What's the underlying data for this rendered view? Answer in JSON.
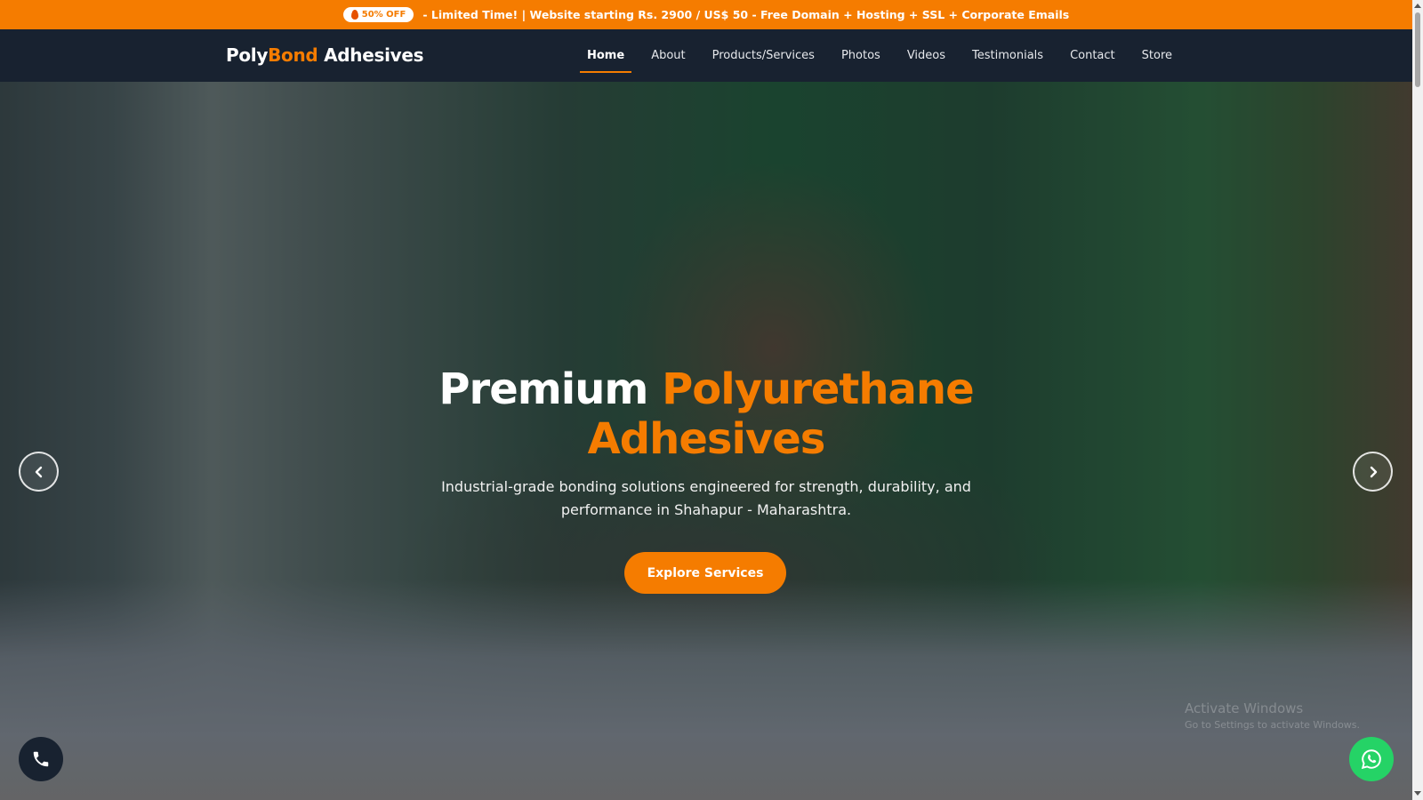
{
  "promo": {
    "badge": "50% OFF",
    "text": "- Limited Time! | Website starting Rs. 2900 / US$ 50 - Free Domain + Hosting + SSL + Corporate Emails"
  },
  "brand": {
    "part1": "Poly",
    "part2": "Bond",
    "part3": " Adhesives"
  },
  "nav": {
    "items": [
      {
        "label": "Home",
        "active": true
      },
      {
        "label": "About"
      },
      {
        "label": "Products/Services"
      },
      {
        "label": "Photos"
      },
      {
        "label": "Videos"
      },
      {
        "label": "Testimonials"
      },
      {
        "label": "Contact"
      },
      {
        "label": "Store"
      }
    ]
  },
  "hero": {
    "title_white": "Premium ",
    "title_orange_line1": "Polyurethane",
    "title_orange_line2": "Adhesives",
    "subtitle": "Industrial-grade bonding solutions engineered for strength, durability, and performance in Shahapur - Maharashtra.",
    "cta": "Explore Services"
  },
  "watermark": {
    "line1": "Activate Windows",
    "line2": "Go to Settings to activate Windows."
  },
  "icons": {
    "flame": "flame-icon",
    "prev": "chevron-left-icon",
    "next": "chevron-right-icon",
    "phone": "phone-icon",
    "whatsapp": "whatsapp-icon"
  },
  "colors": {
    "accent": "#f57c00",
    "nav_bg": "#182230",
    "whatsapp": "#25d366"
  }
}
